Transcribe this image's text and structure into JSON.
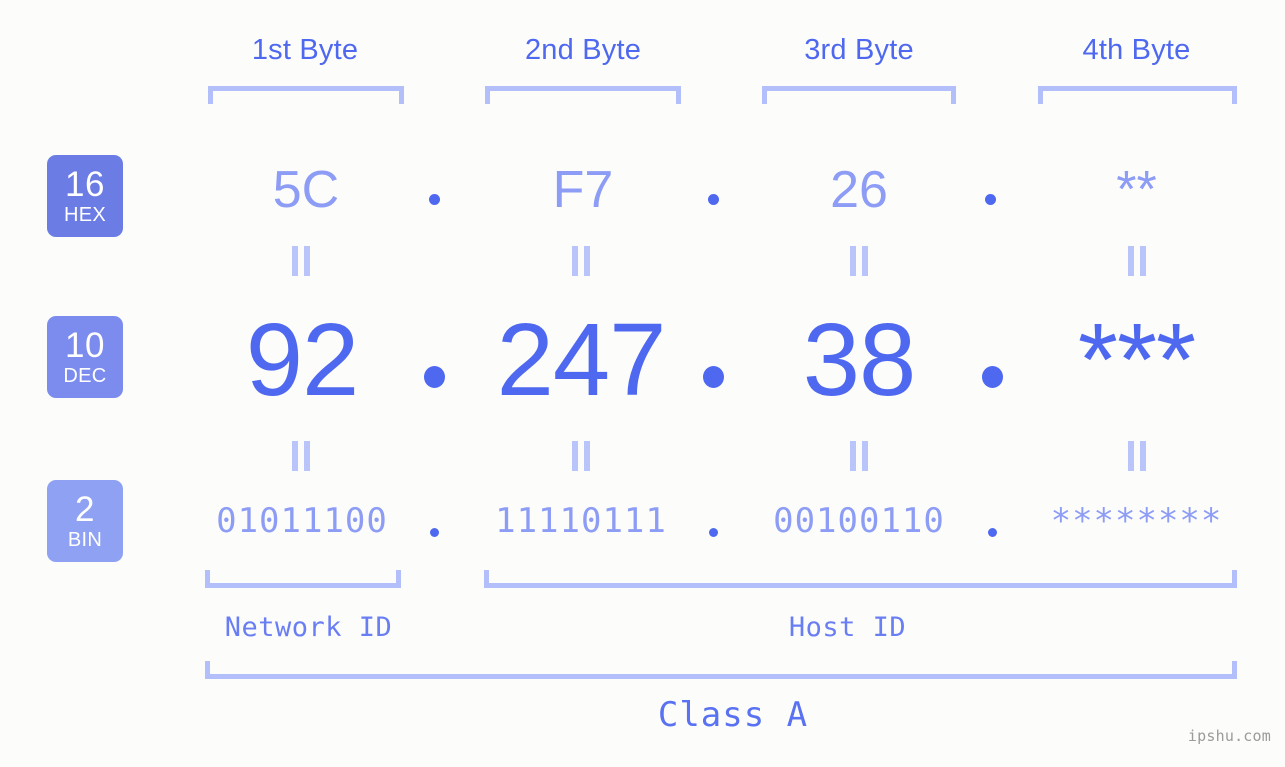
{
  "meta": {
    "watermark": "ipshu.com",
    "background_color": "#fcfdfa",
    "accent_color": "#4f68f0",
    "accent_light_color": "#8d9cf5",
    "bracket_color": "#b3bffb"
  },
  "byte_headers": [
    {
      "label": "1st Byte"
    },
    {
      "label": "2nd Byte"
    },
    {
      "label": "3rd Byte"
    },
    {
      "label": "4th Byte"
    }
  ],
  "rows": [
    {
      "badge_number": "16",
      "badge_name": "HEX",
      "badge_color": "#6b7ce4",
      "values": [
        "5C",
        "F7",
        "26",
        "**"
      ],
      "separators": [
        ".",
        ".",
        "."
      ]
    },
    {
      "badge_number": "10",
      "badge_name": "DEC",
      "badge_color": "#7c8cee",
      "values": [
        "92",
        "247",
        "38",
        "***"
      ],
      "separators": [
        ".",
        ".",
        "."
      ]
    },
    {
      "badge_number": "2",
      "badge_name": "BIN",
      "badge_color": "#8fa1f3",
      "values": [
        "01011100",
        "11110111",
        "00100110",
        "********"
      ],
      "separators": [
        ".",
        ".",
        "."
      ]
    }
  ],
  "connectors": {
    "symbol": "=",
    "rows": 2,
    "columns": 4
  },
  "id_sections": [
    {
      "label": "Network ID"
    },
    {
      "label": "Host ID"
    }
  ],
  "class_section": {
    "label": "Class A"
  }
}
